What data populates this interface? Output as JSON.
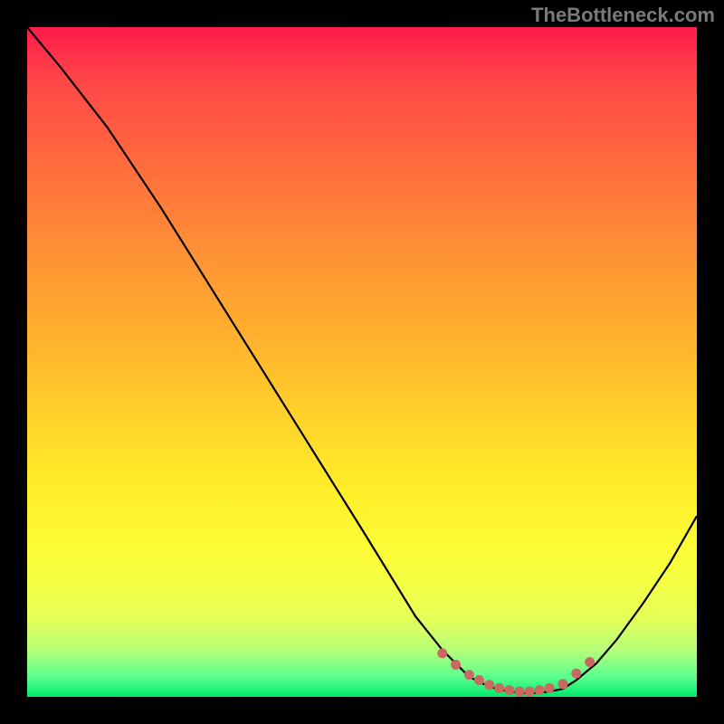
{
  "watermark": "TheBottleneck.com",
  "chart_data": {
    "type": "line",
    "title": "",
    "xlabel": "",
    "ylabel": "",
    "xlim": [
      0,
      100
    ],
    "ylim": [
      0,
      100
    ],
    "grid": false,
    "legend": false,
    "series": [
      {
        "name": "bottleneck-curve",
        "x": [
          0,
          5,
          12,
          20,
          30,
          40,
          50,
          58,
          62,
          66,
          68,
          70,
          72,
          74,
          76,
          78,
          80,
          82,
          85,
          88,
          92,
          96,
          100
        ],
        "y": [
          100,
          94,
          85,
          73,
          57,
          41,
          25,
          12,
          7,
          3,
          2,
          1.2,
          0.8,
          0.6,
          0.6,
          0.8,
          1.2,
          2.5,
          5,
          8.5,
          14,
          20,
          27
        ]
      }
    ],
    "markers": {
      "name": "highlight-dots",
      "x": [
        62,
        64,
        66,
        67.5,
        69,
        70.5,
        72,
        73.5,
        75,
        76.5,
        78,
        80,
        82,
        84
      ],
      "y": [
        6.5,
        4.8,
        3.3,
        2.5,
        1.8,
        1.3,
        1.0,
        0.8,
        0.8,
        1.0,
        1.3,
        1.9,
        3.5,
        5.2
      ]
    },
    "background_gradient": {
      "top": "#ff1a4b",
      "mid": "#ffd22a",
      "bottom": "#00e86a"
    }
  }
}
